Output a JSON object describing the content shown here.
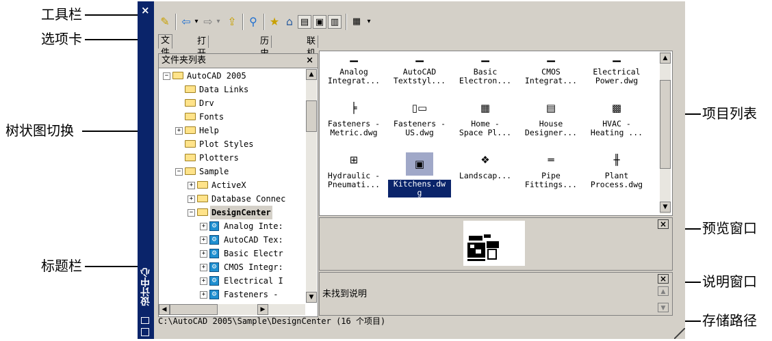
{
  "callouts": {
    "toolbar": "工具栏",
    "tabs": "选项卡",
    "tree_toggle": "树状图切换",
    "titlebar": "标题栏",
    "item_list": "项目列表",
    "preview_window": "预览窗口",
    "description_window": "说明窗口",
    "storage_path": "存储路径"
  },
  "titlebar": {
    "title": "设计中心",
    "close": "×"
  },
  "toolbar": {
    "icons": [
      "load-icon",
      "back-icon",
      "dropdown-icon",
      "forward-icon",
      "dropdown-icon",
      "up-icon",
      "search-icon",
      "favorites-icon",
      "home-icon",
      "tree-toggle-icon",
      "preview-icon",
      "description-icon",
      "views-icon",
      "dropdown-icon"
    ]
  },
  "tabs": [
    {
      "label": "文件夹",
      "active": true
    },
    {
      "label": "打开的图形",
      "active": false
    },
    {
      "label": "历史记录",
      "active": false
    },
    {
      "label": "联机设计中心",
      "active": false
    }
  ],
  "tree": {
    "header": "文件夹列表",
    "close": "×",
    "rows": [
      {
        "label": "AutoCAD 2005",
        "indent": 0,
        "expander": "−",
        "icon": "folder"
      },
      {
        "label": "Data Links",
        "indent": 1,
        "expander": "",
        "icon": "folder"
      },
      {
        "label": "Drv",
        "indent": 1,
        "expander": "",
        "icon": "folder"
      },
      {
        "label": "Fonts",
        "indent": 1,
        "expander": "",
        "icon": "folder"
      },
      {
        "label": "Help",
        "indent": 1,
        "expander": "+",
        "icon": "folder"
      },
      {
        "label": "Plot Styles",
        "indent": 1,
        "expander": "",
        "icon": "folder"
      },
      {
        "label": "Plotters",
        "indent": 1,
        "expander": "",
        "icon": "folder"
      },
      {
        "label": "Sample",
        "indent": 1,
        "expander": "−",
        "icon": "folder"
      },
      {
        "label": "ActiveX",
        "indent": 2,
        "expander": "+",
        "icon": "folder"
      },
      {
        "label": "Database Connec",
        "indent": 2,
        "expander": "+",
        "icon": "folder"
      },
      {
        "label": "DesignCenter",
        "indent": 2,
        "expander": "−",
        "icon": "folder",
        "selected": true
      },
      {
        "label": "Analog Inte:",
        "indent": 3,
        "expander": "+",
        "icon": "dc"
      },
      {
        "label": "AutoCAD Tex:",
        "indent": 3,
        "expander": "+",
        "icon": "dc"
      },
      {
        "label": "Basic Electr",
        "indent": 3,
        "expander": "+",
        "icon": "dc"
      },
      {
        "label": "CMOS Integr:",
        "indent": 3,
        "expander": "+",
        "icon": "dc"
      },
      {
        "label": "Electrical I",
        "indent": 3,
        "expander": "+",
        "icon": "dc"
      },
      {
        "label": "Fasteners -",
        "indent": 3,
        "expander": "+",
        "icon": "dc"
      }
    ]
  },
  "items": [
    {
      "caption": "Analog\nIntegrat...",
      "thumb": "▁"
    },
    {
      "caption": "AutoCAD\nTextstyl...",
      "thumb": "▁"
    },
    {
      "caption": "Basic\nElectron...",
      "thumb": "▁"
    },
    {
      "caption": "CMOS\nIntegrat...",
      "thumb": "▁"
    },
    {
      "caption": "Electrical\nPower.dwg",
      "thumb": "▁"
    },
    {
      "caption": "Fasteners -\nMetric.dwg",
      "thumb": "╞"
    },
    {
      "caption": "Fasteners -\nUS.dwg",
      "thumb": "▯▭"
    },
    {
      "caption": "Home -\nSpace Pl...",
      "thumb": "▦"
    },
    {
      "caption": "House\nDesigner...",
      "thumb": "▤"
    },
    {
      "caption": "HVAC -\nHeating ...",
      "thumb": "▩"
    },
    {
      "caption": "Hydraulic -\nPneumati...",
      "thumb": "⊞"
    },
    {
      "caption": "Kitchens.dw\ng",
      "thumb": "▣",
      "selected": true
    },
    {
      "caption": "Landscap...",
      "thumb": "❖"
    },
    {
      "caption": "Pipe\nFittings...",
      "thumb": "═"
    },
    {
      "caption": "Plant\nProcess.dwg",
      "thumb": "╫"
    }
  ],
  "preview": {
    "close": "×"
  },
  "description": {
    "text": "未找到说明",
    "close": "×"
  },
  "status_path": "C:\\AutoCAD 2005\\Sample\\DesignCenter (16 个项目)"
}
